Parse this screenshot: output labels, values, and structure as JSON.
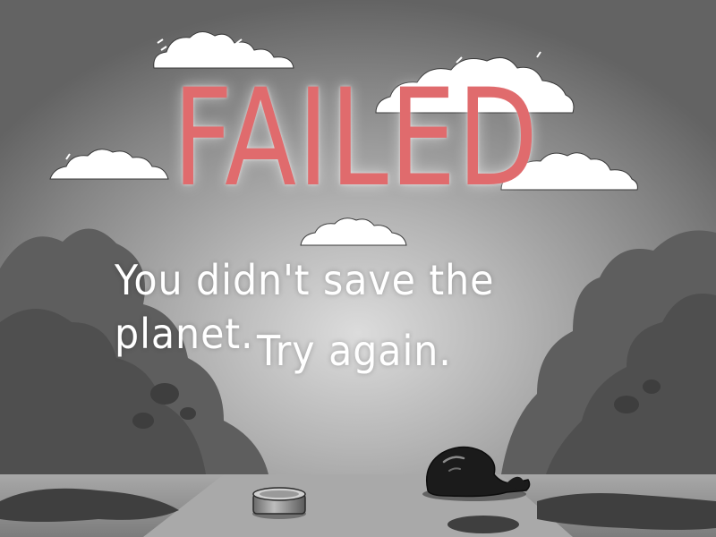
{
  "screen": {
    "title": "FAILED",
    "message_line1": "You didn't save the planet.",
    "message_line2": "Try again."
  },
  "colors": {
    "title": "#e06b6d",
    "message": "#ffffff",
    "sky_top": "#6a6a6a",
    "sky_glow": "#d6d6d6",
    "bushes": "#4e4e4e",
    "ground": "#8a8a8a"
  },
  "scene_objects": [
    "cloud",
    "bush",
    "tin-can",
    "garbage-bag"
  ]
}
